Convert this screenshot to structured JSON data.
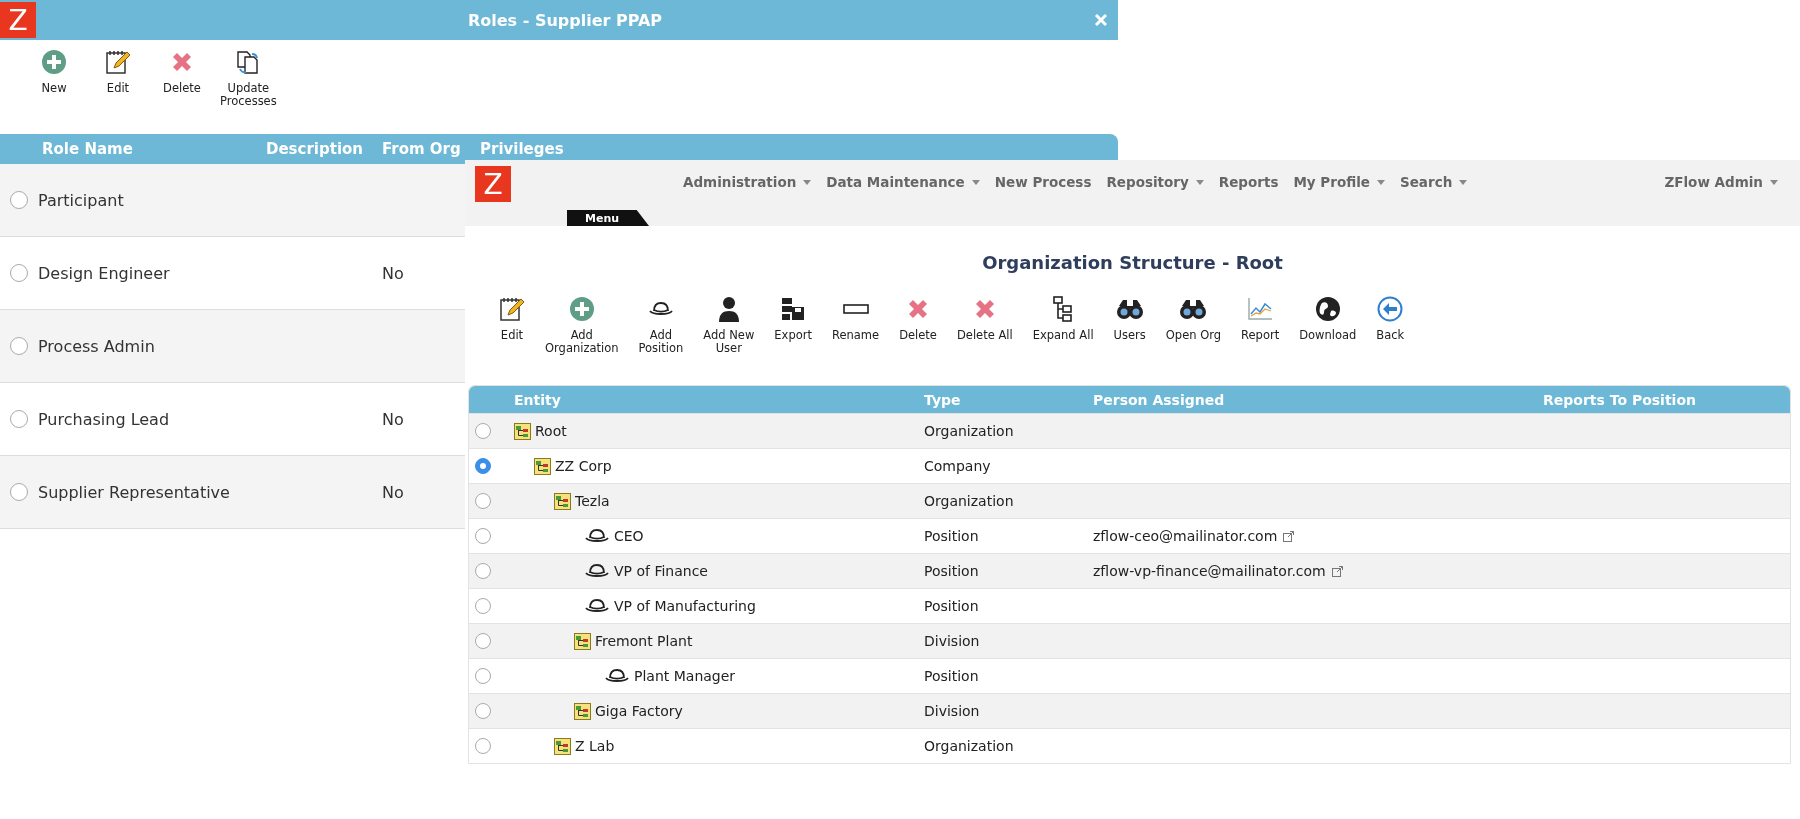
{
  "roles_window": {
    "logo": "Z",
    "title": "Roles - Supplier PPAP",
    "toolbar": [
      {
        "kind": "add",
        "label": "New"
      },
      {
        "kind": "edit",
        "label": "Edit"
      },
      {
        "kind": "delete",
        "label": "Delete"
      },
      {
        "kind": "update",
        "label": "Update\nProcesses"
      }
    ],
    "columns": [
      "Role Name",
      "Description",
      "From Org",
      "Privileges"
    ],
    "rows": [
      {
        "name": "Participant",
        "selected": false
      },
      {
        "name": "Design Engineer",
        "from_org": "No",
        "selected": false
      },
      {
        "name": "Process Admin",
        "selected": false
      },
      {
        "name": "Purchasing Lead",
        "from_org": "No",
        "selected": false
      },
      {
        "name": "Supplier Representative",
        "from_org": "No",
        "selected": false
      }
    ]
  },
  "org_window": {
    "logo": "Z",
    "menu_tab": "Menu",
    "nav": [
      {
        "label": "Administration",
        "menu": true
      },
      {
        "label": "Data Maintenance",
        "menu": true
      },
      {
        "label": "New Process",
        "menu": false
      },
      {
        "label": "Repository",
        "menu": true
      },
      {
        "label": "Reports",
        "menu": false
      },
      {
        "label": "My Profile",
        "menu": true
      },
      {
        "label": "Search",
        "menu": true
      }
    ],
    "user_menu": {
      "label": "ZFlow Admin",
      "menu": true
    },
    "title": "Organization Structure - Root",
    "toolbar": [
      {
        "kind": "edit",
        "label": "Edit"
      },
      {
        "kind": "add",
        "label": "Add\nOrganization"
      },
      {
        "kind": "hat",
        "label": "Add\nPosition"
      },
      {
        "kind": "user",
        "label": "Add New\nUser"
      },
      {
        "kind": "export",
        "label": "Export"
      },
      {
        "kind": "rename",
        "label": "Rename"
      },
      {
        "kind": "delete",
        "label": "Delete"
      },
      {
        "kind": "delete",
        "label": "Delete All"
      },
      {
        "kind": "tree",
        "label": "Expand All"
      },
      {
        "kind": "binoculars",
        "label": "Users"
      },
      {
        "kind": "binoculars",
        "label": "Open Org"
      },
      {
        "kind": "chart",
        "label": "Report"
      },
      {
        "kind": "globe",
        "label": "Download"
      },
      {
        "kind": "back",
        "label": "Back"
      }
    ],
    "columns": [
      "Entity",
      "Type",
      "Person Assigned",
      "Reports To Position"
    ],
    "entities": [
      {
        "kind": "organization",
        "name": "Root",
        "type": "Organization",
        "selected": false,
        "children": [
          {
            "kind": "organization",
            "name": "ZZ Corp",
            "type": "Company",
            "selected": true,
            "children": [
              {
                "kind": "organization",
                "name": "Tezla",
                "type": "Organization",
                "selected": false,
                "children": [
                  {
                    "kind": "position",
                    "name": "CEO",
                    "type": "Position",
                    "person": "zflow-ceo@mailinator.com",
                    "selected": false
                  },
                  {
                    "kind": "position",
                    "name": "VP of Finance",
                    "type": "Position",
                    "person": "zflow-vp-finance@mailinator.com",
                    "selected": false
                  },
                  {
                    "kind": "position",
                    "name": "VP of Manufacturing",
                    "type": "Position",
                    "selected": false
                  },
                  {
                    "kind": "organization",
                    "name": "Fremont Plant",
                    "type": "Division",
                    "selected": false,
                    "children": [
                      {
                        "kind": "position",
                        "name": "Plant Manager",
                        "type": "Position",
                        "selected": false
                      }
                    ]
                  },
                  {
                    "kind": "organization",
                    "name": "Giga Factory",
                    "type": "Division",
                    "selected": false
                  }
                ]
              },
              {
                "kind": "organization",
                "name": "Z Lab",
                "type": "Organization",
                "selected": false
              }
            ]
          }
        ]
      }
    ]
  }
}
